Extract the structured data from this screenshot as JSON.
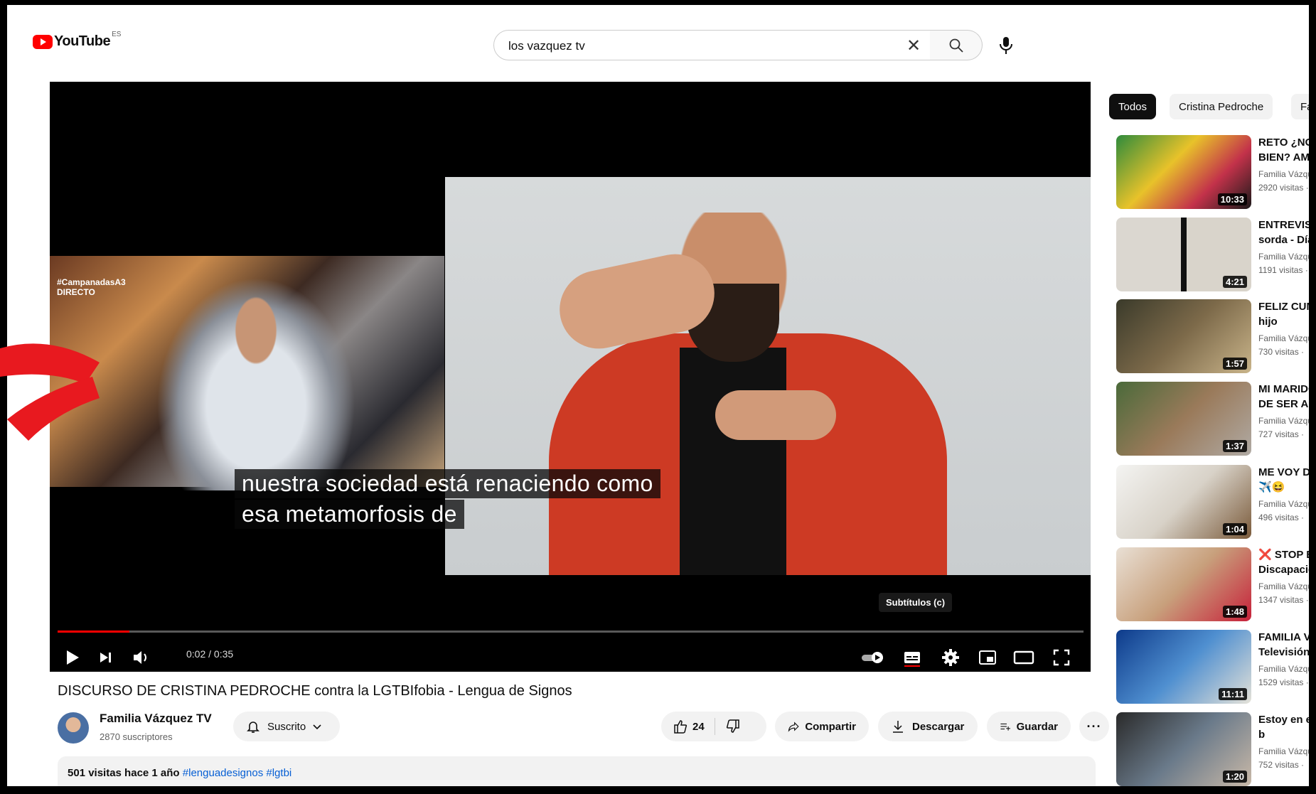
{
  "header": {
    "logo_text": "YouTube",
    "region": "ES",
    "search_value": "los vazquez tv"
  },
  "player": {
    "caption_line1": "nuestra sociedad está renaciendo como",
    "caption_line2": "esa metamorfosis de",
    "tooltip": "Subtítulos (c)",
    "time": "0:02 / 0:35",
    "progress": 0.07,
    "left_tag": "#CampanadasA3\nDIRECTO"
  },
  "video": {
    "title": "DISCURSO DE CRISTINA PEDROCHE contra la LGTBIfobia - Lengua de Signos",
    "channel": "Familia Vázquez TV",
    "subs": "2870 suscriptores",
    "subscribe": "Suscrito",
    "likes": "24",
    "share": "Compartir",
    "download": "Descargar",
    "save": "Guardar",
    "stats": "501 visitas  hace 1 año",
    "tags": "#lenguadesignos #lgtbi"
  },
  "sidebar": {
    "chips": [
      "Todos",
      "Cristina Pedroche",
      "Far"
    ],
    "items": [
      {
        "title": "RETO ¿NOS\nBIEN? AMIG",
        "channel": "Familia Vázqu",
        "views": "2920 visitas ·",
        "duration": "10:33",
        "bg": "linear-gradient(135deg,#2e8b3c,#e8c22a 40%,#c3324a 70%,#1a1a1a)"
      },
      {
        "title": "ENTREVISTA\nsorda - Día I",
        "channel": "Familia Vázqu",
        "views": "1191 visitas ·",
        "duration": "4:21",
        "bg": "linear-gradient(90deg,#dbd7d0 0 48%,#111 48% 52%,#d9d4cb 52%)"
      },
      {
        "title": "FELIZ CUMP\nhijo",
        "channel": "Familia Vázqu",
        "views": "730 visitas ·",
        "duration": "1:57",
        "bg": "linear-gradient(135deg,#3a3a2a,#7d6a4a 50%,#c9b48a)"
      },
      {
        "title": "MI MARIDO\nDE SER ADI",
        "channel": "Familia Vázqu",
        "views": "727 visitas ·",
        "duration": "1:37",
        "bg": "linear-gradient(135deg,#4a6a3a,#9a7a5a 50%,#b0aaa4)"
      },
      {
        "title": "ME VOY DE\n✈️😆",
        "channel": "Familia Vázqu",
        "views": "496 visitas ·",
        "duration": "1:04",
        "bg": "linear-gradient(135deg,#f4f4f2,#d8d2c8 50%,#7a5a3a)"
      },
      {
        "title": "❌ STOP BR\nDiscapacida",
        "channel": "Familia Vázqu",
        "views": "1347 visitas ·",
        "duration": "1:48",
        "bg": "linear-gradient(135deg,#e9e0d5,#c8a07c 50%,#c7213a)"
      },
      {
        "title": "FAMILIA VÁ\nTelevisión d",
        "channel": "Familia Vázqu",
        "views": "1529 visitas ·",
        "duration": "11:11",
        "bg": "linear-gradient(135deg,#0d3a8a,#4f8fd0 50%,#e5e2d8)"
      },
      {
        "title": "Estoy en el b\nSIN BARRER",
        "channel": "Familia Vázqu",
        "views": "752 visitas ·",
        "duration": "1:20",
        "bg": "linear-gradient(135deg,#2a2a2a,#6a7a8a 50%,#c9b9a8)"
      }
    ]
  },
  "colors": {
    "accent": "#ff0000",
    "annotation_arrow": "#e8191f"
  },
  "icons": [
    "youtube-logo-icon",
    "clear-icon",
    "search-icon",
    "mic-icon",
    "play-icon",
    "next-icon",
    "volume-icon",
    "autoplay-toggle-icon",
    "subtitles-icon",
    "settings-icon",
    "miniplayer-icon",
    "theater-icon",
    "fullscreen-icon",
    "bell-icon",
    "chevron-down-icon",
    "like-icon",
    "dislike-icon",
    "share-icon",
    "download-icon",
    "save-icon",
    "more-icon"
  ]
}
